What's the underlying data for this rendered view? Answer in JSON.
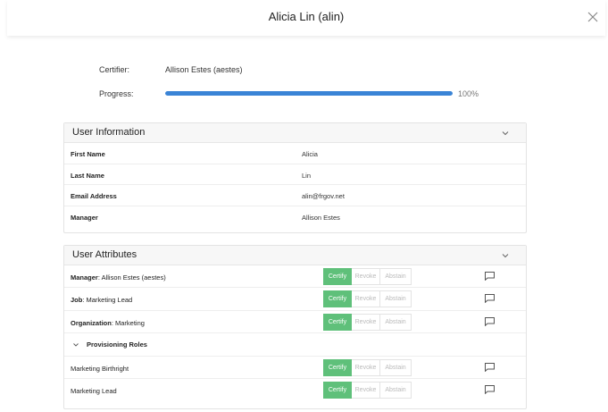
{
  "modal": {
    "title": "Alicia Lin (alin)",
    "close_icon": "close-icon"
  },
  "meta": {
    "certifier_label": "Certifier:",
    "certifier_value": "Allison Estes (aestes)",
    "progress_label": "Progress:",
    "progress_percent": 100,
    "progress_text": "100%"
  },
  "colors": {
    "progress": "#3a84d6",
    "certify": "#5fc07a"
  },
  "user_info": {
    "title": "User Information",
    "rows": [
      {
        "key": "First Name",
        "value": "Alicia"
      },
      {
        "key": "Last Name",
        "value": "Lin"
      },
      {
        "key": "Email Address",
        "value": "alin@frgov.net"
      },
      {
        "key": "Manager",
        "value": "Allison Estes"
      }
    ]
  },
  "user_attributes": {
    "title": "User Attributes",
    "certify_label": "Certify",
    "revoke_label": "Revoke",
    "abstain_label": "Abstain",
    "rows": [
      {
        "name": "Manager",
        "value": ": Allison Estes (aestes)"
      },
      {
        "name": "Job",
        "value": ": Marketing Lead"
      },
      {
        "name": "Organization",
        "value": ": Marketing"
      }
    ],
    "group": {
      "title": "Provisioning Roles",
      "rows": [
        {
          "value": "Marketing Birthright"
        },
        {
          "value": "Marketing Lead"
        }
      ]
    }
  }
}
